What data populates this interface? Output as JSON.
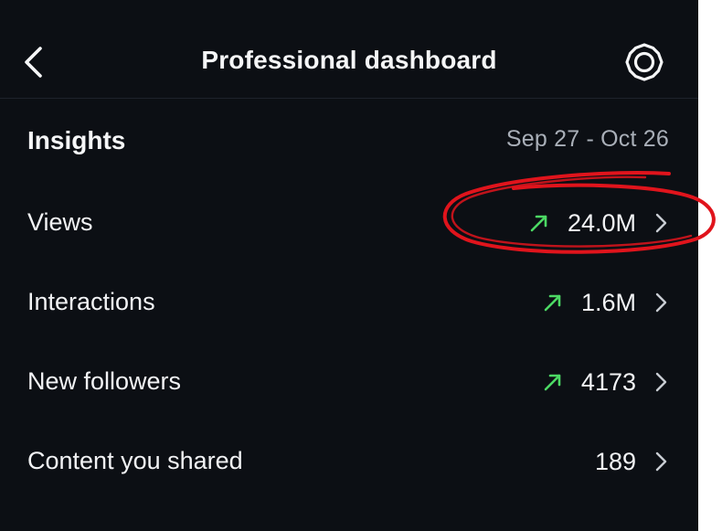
{
  "header": {
    "title": "Professional dashboard",
    "back_icon": "chevron-left-icon",
    "settings_icon": "gear-icon"
  },
  "insights": {
    "title": "Insights",
    "date_range": "Sep 27 - Oct 26",
    "rows": [
      {
        "label": "Views",
        "value": "24.0M",
        "trend": "up",
        "highlighted": true
      },
      {
        "label": "Interactions",
        "value": "1.6M",
        "trend": "up"
      },
      {
        "label": "New followers",
        "value": "4173",
        "trend": "up"
      },
      {
        "label": "Content you shared",
        "value": "189",
        "trend": "none"
      }
    ]
  },
  "colors": {
    "background": "#0c0f14",
    "text": "#f2f3f5",
    "muted": "#a9afb8",
    "trend_up": "#4cd964",
    "annotation": "#e0141c"
  }
}
